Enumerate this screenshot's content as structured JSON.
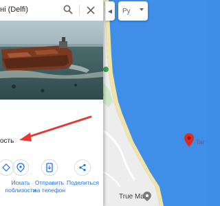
{
  "search": {
    "value": "ні (Delfi)"
  },
  "language": {
    "selected": "Ру"
  },
  "panel": {
    "description_fragment": "ость",
    "actions": [
      {
        "label_line1": "Искать",
        "label_line2": "поблизости",
        "icon": "nearby-icon"
      },
      {
        "label_line1": "Отправить",
        "label_line2": "на телефон",
        "icon": "send-to-phone-icon"
      },
      {
        "label_line1": "Поделиться",
        "label_line2": "",
        "icon": "share-icon"
      }
    ]
  },
  "map": {
    "place_label": "Tar",
    "poi_label": "True Man"
  },
  "colors": {
    "water": "#3f8fe9",
    "beach": "#f1e4a6",
    "land": "#eeeeee",
    "place_pin": "#d93025",
    "accent": "#1a73e8",
    "arrow": "#e53935"
  }
}
